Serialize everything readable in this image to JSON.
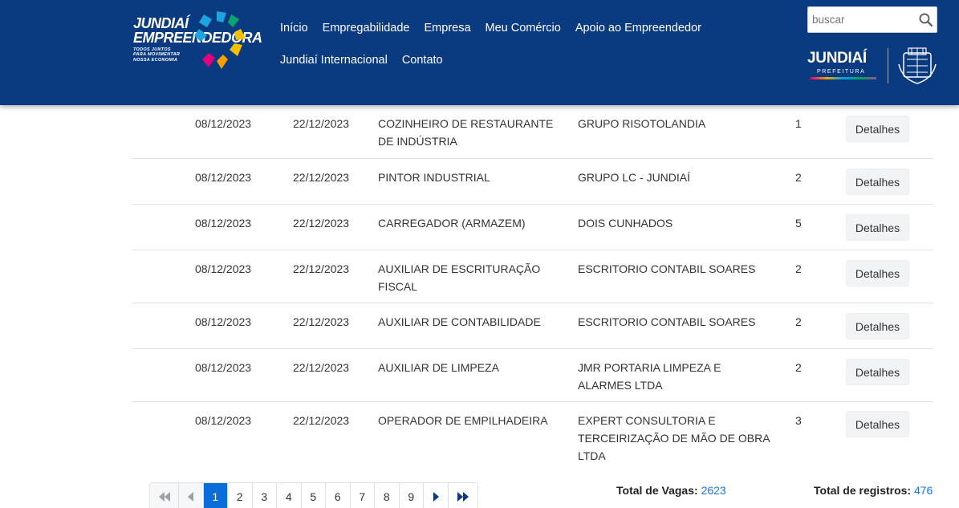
{
  "header": {
    "logo": {
      "line1": "JUNDIAÍ",
      "line2": "EMPREENDEDORA",
      "tag1": "TODOS JUNTOS",
      "tag2": "PARA MOVIMENTAR",
      "tag3": "NOSSA ECONOMIA"
    },
    "nav_row1": [
      "Início",
      "Empregabilidade",
      "Empresa",
      "Meu Comércio",
      "Apoio ao Empreendedor"
    ],
    "nav_row2": [
      "Jundiaí Internacional",
      "Contato"
    ],
    "search": {
      "placeholder": "buscar"
    },
    "city_logo": {
      "word": "JUNDIAÍ",
      "sub": "PREFEITURA"
    }
  },
  "jobs": {
    "rows": [
      {
        "date_start": "08/12/2023",
        "date_end": "22/12/2023",
        "job": "COZINHEIRO DE RESTAURANTE DE INDÚSTRIA",
        "company": "GRUPO RISOTOLANDIA",
        "qty": "1",
        "button": "Detalhes"
      },
      {
        "date_start": "08/12/2023",
        "date_end": "22/12/2023",
        "job": "PINTOR INDUSTRIAL",
        "company": "GRUPO LC - JUNDIAÍ",
        "qty": "2",
        "button": "Detalhes"
      },
      {
        "date_start": "08/12/2023",
        "date_end": "22/12/2023",
        "job": "CARREGADOR (ARMAZEM)",
        "company": "DOIS CUNHADOS",
        "qty": "5",
        "button": "Detalhes"
      },
      {
        "date_start": "08/12/2023",
        "date_end": "22/12/2023",
        "job": "AUXILIAR DE ESCRITURAÇÃO FISCAL",
        "company": "ESCRITORIO CONTABIL SOARES",
        "qty": "2",
        "button": "Detalhes"
      },
      {
        "date_start": "08/12/2023",
        "date_end": "22/12/2023",
        "job": "AUXILIAR DE CONTABILIDADE",
        "company": "ESCRITORIO CONTABIL SOARES",
        "qty": "2",
        "button": "Detalhes"
      },
      {
        "date_start": "08/12/2023",
        "date_end": "22/12/2023",
        "job": "AUXILIAR DE LIMPEZA",
        "company": "JMR PORTARIA LIMPEZA E ALARMES LTDA",
        "qty": "2",
        "button": "Detalhes"
      },
      {
        "date_start": "08/12/2023",
        "date_end": "22/12/2023",
        "job": "OPERADOR DE EMPILHADEIRA",
        "company": "EXPERT CONSULTORIA E TERCEIRIZAÇÃO DE MÃO DE OBRA LTDA",
        "qty": "3",
        "button": "Detalhes"
      }
    ]
  },
  "pagination": {
    "pages": [
      "1",
      "2",
      "3",
      "4",
      "5",
      "6",
      "7",
      "8",
      "9"
    ],
    "active": "1"
  },
  "totals": {
    "vagas_label": "Total de Vagas:",
    "vagas_value": "2623",
    "registros_label": "Total de registros:",
    "registros_value": "476"
  },
  "colors": {
    "header_bg": "#0a3a80",
    "active_page": "#0a6dd9",
    "link_number": "#1a73e8"
  }
}
